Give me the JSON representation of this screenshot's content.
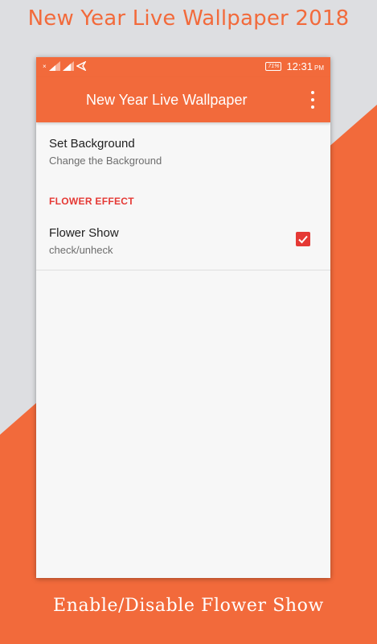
{
  "promo": {
    "title": "New Year Live Wallpaper 2018",
    "caption": "Enable/Disable Flower Show"
  },
  "status_bar": {
    "battery": "71%",
    "time": "12:31",
    "ampm": "PM"
  },
  "app_bar": {
    "title": "New Year Live Wallpaper"
  },
  "preferences": {
    "set_background": {
      "title": "Set Background",
      "summary": "Change the Background"
    },
    "category_label": "FLOWER EFFECT",
    "flower_show": {
      "title": "Flower Show",
      "summary": "check/unheck",
      "checked": true
    }
  },
  "colors": {
    "accent": "#f26a3b",
    "checkbox": "#e53935",
    "background": "#dddee1"
  },
  "icons": [
    "signal-icon",
    "signal-icon",
    "location-arrow-icon",
    "battery-icon",
    "more-vert-icon",
    "check-icon"
  ]
}
